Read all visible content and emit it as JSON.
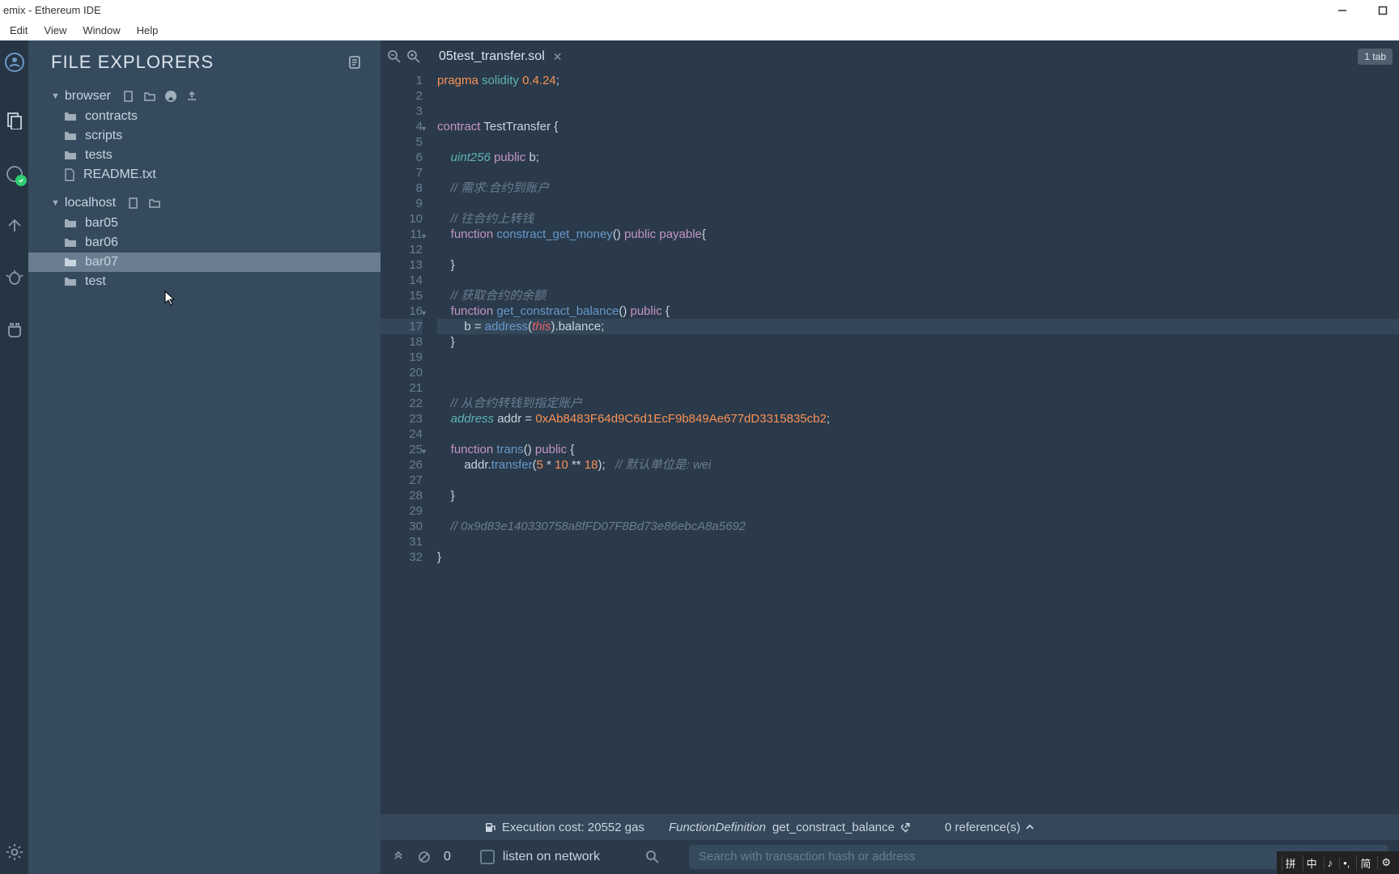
{
  "window": {
    "title": "emix - Ethereum IDE"
  },
  "menubar": [
    "Edit",
    "View",
    "Window",
    "Help"
  ],
  "sidebar": {
    "title": "FILE EXPLORERS",
    "roots": [
      {
        "name": "browser",
        "children": [
          {
            "name": "contracts",
            "type": "folder"
          },
          {
            "name": "scripts",
            "type": "folder"
          },
          {
            "name": "tests",
            "type": "folder"
          },
          {
            "name": "README.txt",
            "type": "file"
          }
        ]
      },
      {
        "name": "localhost",
        "children": [
          {
            "name": "bar05",
            "type": "folder"
          },
          {
            "name": "bar06",
            "type": "folder"
          },
          {
            "name": "bar07",
            "type": "folder",
            "selected": true
          },
          {
            "name": "test",
            "type": "folder"
          }
        ]
      }
    ]
  },
  "tabs": {
    "active": "05test_transfer.sol",
    "count_label": "1 tab"
  },
  "code": {
    "lines": [
      {
        "n": 1,
        "html": "<span class='pragma'>pragma</span> <span class='kw2'>solidity</span> <span class='num'>0.4.24</span>;"
      },
      {
        "n": 2,
        "html": ""
      },
      {
        "n": 3,
        "html": ""
      },
      {
        "n": 4,
        "fold": true,
        "html": "<span class='kw'>contract</span> <span class='ident'>TestTransfer</span> {"
      },
      {
        "n": 5,
        "html": ""
      },
      {
        "n": 6,
        "html": "    <span class='type'>uint256</span> <span class='modifier'>public</span> <span class='ident'>b</span>;"
      },
      {
        "n": 7,
        "html": ""
      },
      {
        "n": 8,
        "html": "    <span class='comment'>// 需求:合约到账户</span>"
      },
      {
        "n": 9,
        "html": ""
      },
      {
        "n": 10,
        "html": "    <span class='comment'>// 往合约上转钱</span>"
      },
      {
        "n": 11,
        "fold": true,
        "html": "    <span class='kw'>function</span> <span class='fn'>constract_get_money</span>() <span class='modifier'>public</span> <span class='modifier'>payable</span>{"
      },
      {
        "n": 12,
        "html": ""
      },
      {
        "n": 13,
        "html": "    }"
      },
      {
        "n": 14,
        "html": ""
      },
      {
        "n": 15,
        "html": "    <span class='comment'>// 获取合约的余额</span>"
      },
      {
        "n": 16,
        "fold": true,
        "html": "    <span class='kw'>function</span> <span class='fn'>get_constract_balance</span>() <span class='modifier'>public</span> {"
      },
      {
        "n": 17,
        "current": true,
        "html": "        <span class='ident'>b</span> = <span class='fn'>address</span>(<span class='special'>this</span>).<span class='ident'>balance</span>;"
      },
      {
        "n": 18,
        "html": "    }"
      },
      {
        "n": 19,
        "html": ""
      },
      {
        "n": 20,
        "html": ""
      },
      {
        "n": 21,
        "html": ""
      },
      {
        "n": 22,
        "html": "    <span class='comment'>// 从合约转钱到指定账户</span>"
      },
      {
        "n": 23,
        "html": "    <span class='type'>address</span> <span class='ident'>addr</span> = <span class='num'>0xAb8483F64d9C6d1EcF9b849Ae677dD3315835cb2</span>;"
      },
      {
        "n": 24,
        "html": ""
      },
      {
        "n": 25,
        "fold": true,
        "html": "    <span class='kw'>function</span> <span class='fn'>trans</span>() <span class='modifier'>public</span> {"
      },
      {
        "n": 26,
        "html": "        <span class='ident'>addr</span>.<span class='fn'>transfer</span>(<span class='num'>5</span> * <span class='num'>10</span> ** <span class='num'>18</span>);   <span class='comment'>// 默认单位是: wei</span>"
      },
      {
        "n": 27,
        "html": ""
      },
      {
        "n": 28,
        "html": "    }"
      },
      {
        "n": 29,
        "html": ""
      },
      {
        "n": 30,
        "html": "    <span class='comment'>// 0x9d83e140330758a8fFD07F8Bd73e86ebcA8a5692</span>"
      },
      {
        "n": 31,
        "html": ""
      },
      {
        "n": 32,
        "html": "}"
      }
    ]
  },
  "status": {
    "gas": "Execution cost: 20552 gas",
    "fn_type": "FunctionDefinition",
    "fn_name": " get_constract_balance",
    "refs": "0 reference(s)"
  },
  "searchbar": {
    "count": "0",
    "listen_label": "listen on network",
    "placeholder": "Search with transaction hash or address"
  },
  "ime": [
    "拼",
    "中",
    "♪",
    "简"
  ]
}
